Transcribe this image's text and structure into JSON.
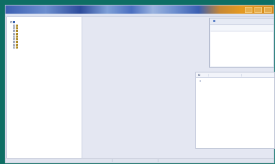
{
  "window": {
    "title": "",
    "colors": {
      "titlebar": "#3b5fb2",
      "accent": "#e49a22",
      "workspace": "#e4e7f2",
      "desktop": "#0e6e64"
    }
  },
  "tree": {
    "items": [
      {
        "label": "",
        "level": 0,
        "icon": "computer-icon",
        "selected": true
      },
      {
        "label": "",
        "level": 1,
        "icon": "folder-icon"
      },
      {
        "label": "",
        "level": 1,
        "icon": "folder-icon"
      },
      {
        "label": "",
        "level": 1,
        "icon": "folder-icon"
      },
      {
        "label": "",
        "level": 1,
        "icon": "folder-icon"
      },
      {
        "label": "",
        "level": 1,
        "icon": "folder-icon"
      },
      {
        "label": "",
        "level": 1,
        "icon": "folder-icon"
      },
      {
        "label": "",
        "level": 1,
        "icon": "folder-icon"
      },
      {
        "label": "",
        "level": 1,
        "icon": "folder-icon"
      },
      {
        "label": "",
        "level": 1,
        "icon": "folder-icon"
      }
    ]
  },
  "panel_a": {
    "toolbar_label": "",
    "columns": [
      "",
      ""
    ]
  },
  "panel_b": {
    "columns": [
      "",
      ""
    ]
  },
  "status": {
    "cells": [
      "",
      "",
      ""
    ]
  }
}
